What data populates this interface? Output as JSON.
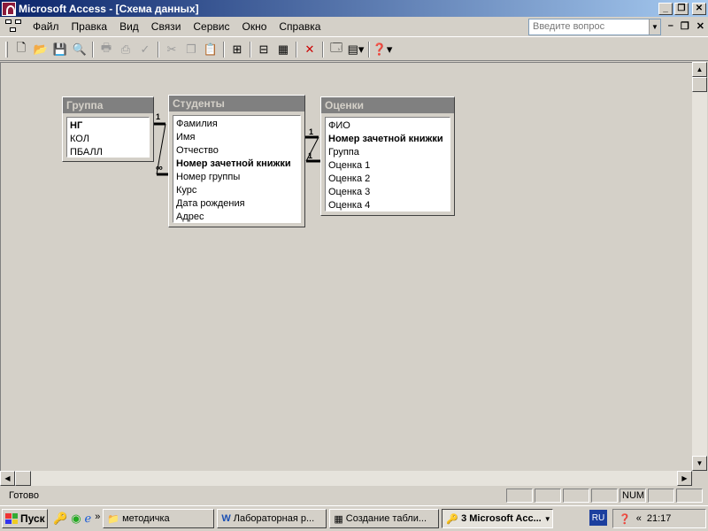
{
  "window": {
    "title": "Microsoft Access - [Схема данных]",
    "controls": {
      "minimize": "_",
      "restore": "❐",
      "close": "✕"
    }
  },
  "menu": {
    "items": [
      "Файл",
      "Правка",
      "Вид",
      "Связи",
      "Сервис",
      "Окно",
      "Справка"
    ],
    "help_placeholder": "Введите вопрос",
    "mdi_controls": {
      "minimize": "–",
      "restore": "❐",
      "close": "✕"
    }
  },
  "tables": [
    {
      "title": "Группа",
      "fields": [
        {
          "name": "НГ",
          "key": true
        },
        {
          "name": "КОЛ",
          "key": false
        },
        {
          "name": "ПБАЛЛ",
          "key": false
        }
      ]
    },
    {
      "title": "Студенты",
      "fields": [
        {
          "name": "Фамилия",
          "key": false
        },
        {
          "name": "Имя",
          "key": false
        },
        {
          "name": "Отчество",
          "key": false
        },
        {
          "name": "Номер зачетной книжки",
          "key": true
        },
        {
          "name": "Номер группы",
          "key": false
        },
        {
          "name": "Курс",
          "key": false
        },
        {
          "name": "Дата рождения",
          "key": false
        },
        {
          "name": "Адрес",
          "key": false
        }
      ]
    },
    {
      "title": "Оценки",
      "fields": [
        {
          "name": "ФИО",
          "key": false
        },
        {
          "name": "Номер зачетной книжки",
          "key": true
        },
        {
          "name": "Группа",
          "key": false
        },
        {
          "name": "Оценка 1",
          "key": false
        },
        {
          "name": "Оценка 2",
          "key": false
        },
        {
          "name": "Оценка 3",
          "key": false
        },
        {
          "name": "Оценка 4",
          "key": false
        }
      ]
    }
  ],
  "relations": [
    {
      "one_label": "1",
      "many_label": "∞"
    },
    {
      "one_label": "1",
      "many_label": "1"
    }
  ],
  "statusbar": {
    "text": "Готово",
    "num": "NUM"
  },
  "taskbar": {
    "start": "Пуск",
    "tasks": [
      "методичка",
      "Лабораторная р...",
      "Создание табли...",
      "3 Microsoft Acc..."
    ],
    "lang": "RU",
    "clock": "21:17"
  }
}
